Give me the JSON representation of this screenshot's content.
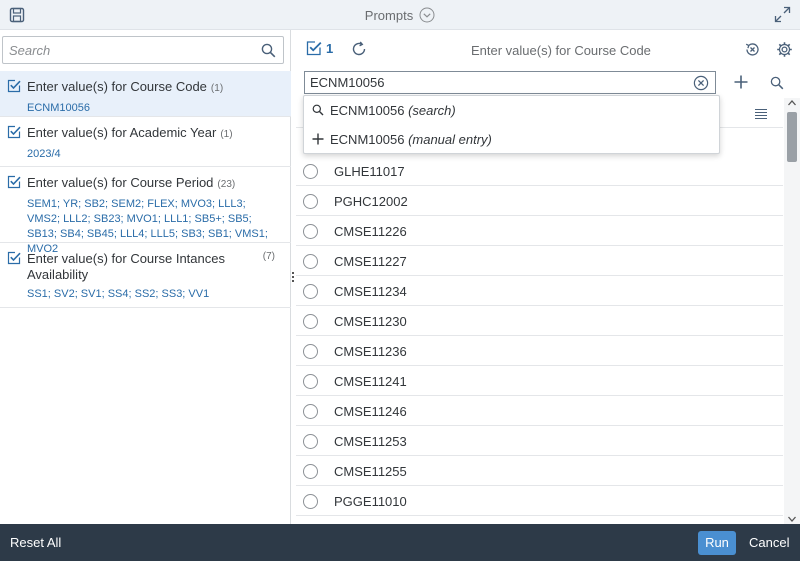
{
  "window": {
    "title": "Prompts"
  },
  "left_panel": {
    "search_placeholder": "Search",
    "prompts": [
      {
        "title": "Enter value(s) for Course Code",
        "count": "(1)",
        "values": "ECNM10056",
        "selected": true
      },
      {
        "title": "Enter value(s) for Academic Year",
        "count": "(1)",
        "values": "2023/4",
        "selected": false
      },
      {
        "title": "Enter value(s) for Course Period",
        "count": "(23)",
        "values": "SEM1; YR; SB2; SEM2; FLEX; MVO3; LLL3; VMS2; LLL2; SB23; MVO1; LLL1; SB5+; SB5; SB13; SB4; SB45; LLL4; LLL5; SB3; SB1; VMS1; MVO2",
        "selected": false
      },
      {
        "title": "Enter value(s) for Course Intances Availability",
        "count": "(7)",
        "values": "SS1; SV2; SV1; SS4; SS2; SS3; VV1",
        "selected": false
      }
    ]
  },
  "right_panel": {
    "selected_count": "1",
    "title": "Enter value(s) for Course Code",
    "input_value": "ECNM10056",
    "suggestions": [
      {
        "value": "ECNM10056",
        "tag": "(search)",
        "icon": "search-icon"
      },
      {
        "value": "ECNM10056",
        "tag": "(manual entry)",
        "icon": "plus-icon"
      }
    ],
    "values": [
      "GLHE11017",
      "PGHC12002",
      "CMSE11226",
      "CMSE11227",
      "CMSE11234",
      "CMSE11230",
      "CMSE11236",
      "CMSE11241",
      "CMSE11246",
      "CMSE11253",
      "CMSE11255",
      "PGGE11010"
    ]
  },
  "footer": {
    "reset_label": "Reset All",
    "run_label": "Run",
    "cancel_label": "Cancel"
  },
  "colors": {
    "accent": "#2a6ca8",
    "run_button": "#4a8fd1",
    "footer_bg": "#2d3a48",
    "selected_bg": "#e8f0fa"
  }
}
